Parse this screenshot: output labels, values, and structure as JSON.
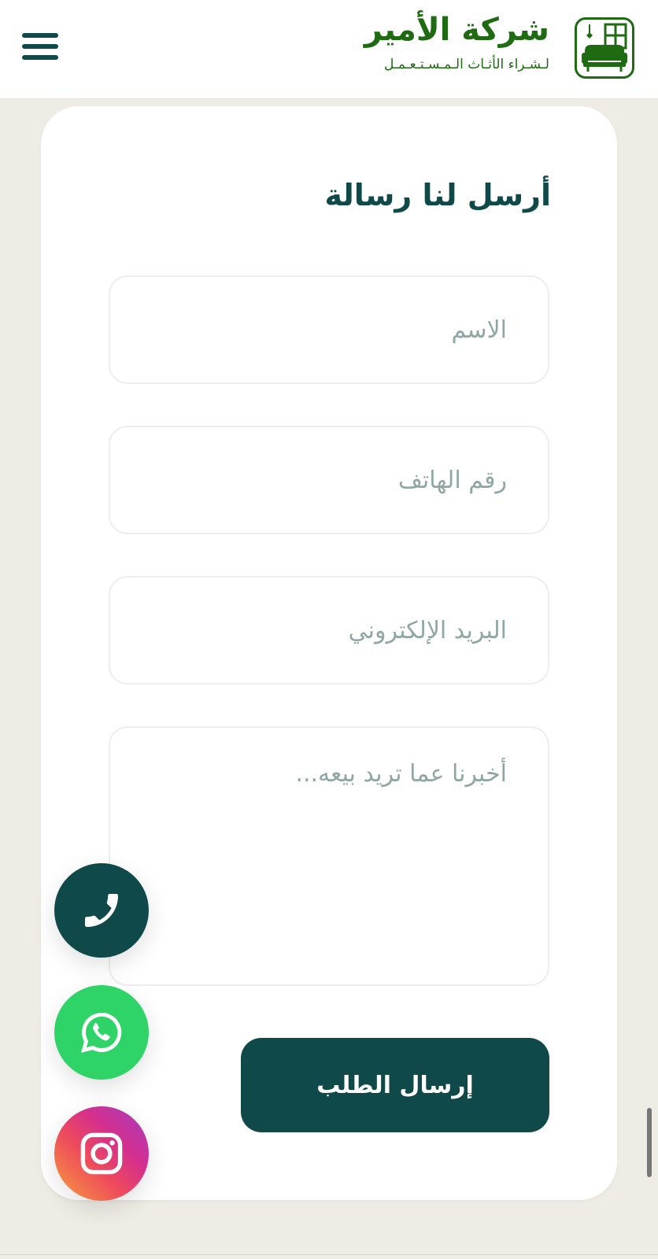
{
  "header": {
    "brand_title": "شركة الأمير",
    "brand_subtitle": "لـشـراء الأثـاث الـمـسـتـعـمـل",
    "logo_icon": "sofa-window-icon",
    "menu_icon": "hamburger-icon"
  },
  "form": {
    "title": "أرسل لنا رسالة",
    "name_placeholder": "الاسم",
    "phone_placeholder": "رقم الهاتف",
    "email_placeholder": "البريد الإلكتروني",
    "message_placeholder": "أخبرنا عما تريد بيعه...",
    "submit_label": "إرسال الطلب"
  },
  "floating_actions": [
    {
      "icon": "phone-icon",
      "color": "#10494a"
    },
    {
      "icon": "whatsapp-icon",
      "color": "#2fd468"
    },
    {
      "icon": "instagram-icon",
      "color": "#d52f8e"
    }
  ],
  "colors": {
    "brand_green": "#1e6b12",
    "primary_dark": "#10494a",
    "background": "#efece6"
  }
}
